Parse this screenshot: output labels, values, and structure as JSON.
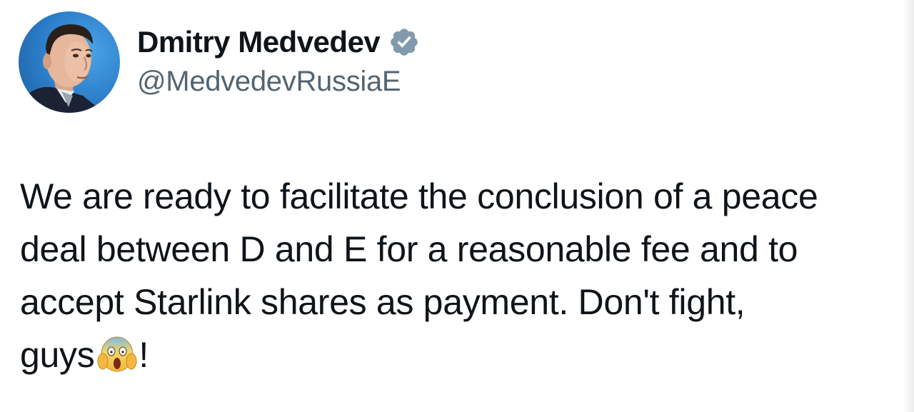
{
  "author": {
    "display_name": "Dmitry Medvedev",
    "handle": "@MedvedevRussiaE",
    "verified_icon": "verified-badge-icon",
    "avatar": "profile-photo"
  },
  "tweet": {
    "lines": [
      "We are ready to facilitate the conclusion of a peace",
      "deal between D and E for a reasonable fee and to",
      "accept Starlink shares as payment. Don't fight,"
    ],
    "last_line_text": "guys",
    "emoji": "face-screaming-in-fear-emoji",
    "last_line_suffix": "!"
  },
  "colors": {
    "text_primary": "#0f1419",
    "text_secondary": "#536471",
    "verified_badge": "#829aab",
    "background": "#ffffff"
  }
}
